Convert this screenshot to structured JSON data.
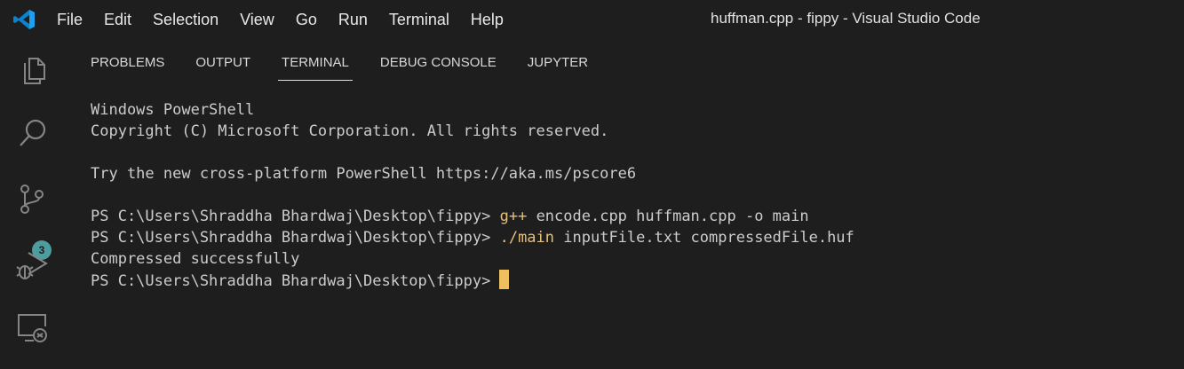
{
  "window": {
    "title": "huffman.cpp - fippy - Visual Studio Code",
    "logo": "vscode-logo-icon"
  },
  "menu": [
    "File",
    "Edit",
    "Selection",
    "View",
    "Go",
    "Run",
    "Terminal",
    "Help"
  ],
  "activity_bar": {
    "icons": [
      "explorer-icon",
      "search-icon",
      "source-control-icon",
      "run-debug-icon",
      "remote-explorer-icon"
    ],
    "source_control_badge": "3"
  },
  "panel": {
    "tabs": [
      "PROBLEMS",
      "OUTPUT",
      "TERMINAL",
      "DEBUG CONSOLE",
      "JUPYTER"
    ],
    "active_tab": "TERMINAL"
  },
  "terminal": {
    "lines": [
      "Windows PowerShell",
      "Copyright (C) Microsoft Corporation. All rights reserved.",
      "",
      "Try the new cross-platform PowerShell https://aka.ms/pscore6",
      ""
    ],
    "prompt": "PS C:\\Users\\Shraddha Bhardwaj\\Desktop\\fippy>",
    "cmd1": {
      "exe": "g++",
      "args": "encode.cpp huffman.cpp -o main"
    },
    "cmd2": {
      "exe": "./main",
      "args": "inputFile.txt compressedFile.huf"
    },
    "output": "Compressed successfully"
  },
  "colors": {
    "background": "#1e1e1e",
    "text": "#cccccc",
    "command": "#e5c07b",
    "cursor": "#f0c060",
    "badge": "#4d9c9e",
    "vscode_blue": "#0a84d0"
  }
}
